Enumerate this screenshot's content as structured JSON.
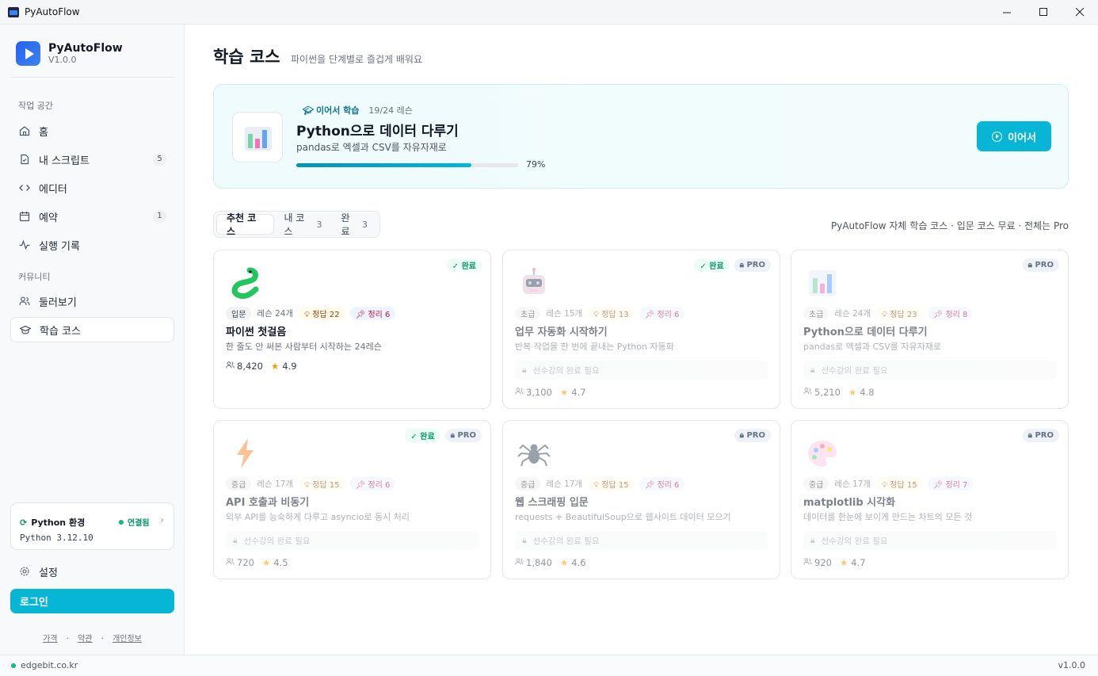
{
  "window": {
    "title": "PyAutoFlow"
  },
  "brand": {
    "name": "PyAutoFlow",
    "version": "V1.0.0"
  },
  "sidebar": {
    "workspace_label": "작업 공간",
    "items": [
      {
        "label": "홈",
        "icon": "home-icon"
      },
      {
        "label": "내 스크립트",
        "icon": "file-icon",
        "badge": "5"
      },
      {
        "label": "에디터",
        "icon": "code-icon"
      },
      {
        "label": "예약",
        "icon": "calendar-icon",
        "badge": "1"
      },
      {
        "label": "실행 기록",
        "icon": "activity-icon"
      }
    ],
    "community_label": "커뮤니티",
    "community_items": [
      {
        "label": "둘러보기",
        "icon": "users-icon"
      },
      {
        "label": "학습 코스",
        "icon": "graduation-cap-icon"
      }
    ],
    "python_env": {
      "title": "Python 환경",
      "status": "연결됨",
      "version": "Python 3.12.10"
    },
    "settings_label": "설정",
    "login_label": "로그인",
    "footer": {
      "pricing": "가격",
      "terms": "약관",
      "privacy": "개인정보"
    }
  },
  "statusbar": {
    "site": "edgebit.co.kr",
    "version": "v1.0.0"
  },
  "page": {
    "title": "학습 코스",
    "subtitle": "파이썬을 단계별로 즐겁게 배워요"
  },
  "hero": {
    "tag": "이어서 학습",
    "count": "19/24 레슨",
    "title": "Python으로 데이터 다루기",
    "subtitle": "pandas로 엑셀과 CSV를 자유자재로",
    "progress": 0.79,
    "progress_label": "79%",
    "button": "이어서"
  },
  "tabs": [
    {
      "label": "추천 코스",
      "count": ""
    },
    {
      "label": "내 코스",
      "count": "3"
    },
    {
      "label": "완료",
      "count": "3"
    }
  ],
  "tabs_note": "PyAutoFlow 자체 학습 코스 · 입문 코스 무료 · 전체는 Pro",
  "labels": {
    "done": "완료",
    "pro": "PRO",
    "lock": "선수강의 완료 필요"
  },
  "courses": [
    {
      "level": "입문",
      "lessons": "레슨 24개",
      "answers": "정답 22",
      "summary": "정리 6",
      "title": "파이썬 첫걸음",
      "desc": "한 줄도 안 써본 사람부터 시작하는 24레슨",
      "students": "8,420",
      "rating": "4.9",
      "done": true,
      "pro": false,
      "locked": false,
      "icon": "snake-icon"
    },
    {
      "level": "초급",
      "lessons": "레슨 15개",
      "answers": "정답 13",
      "summary": "정리 6",
      "title": "업무 자동화 시작하기",
      "desc": "반복 작업을 한 번에 끝내는 Python 자동화",
      "students": "3,100",
      "rating": "4.7",
      "done": true,
      "pro": true,
      "locked": true,
      "icon": "robot-icon"
    },
    {
      "level": "초급",
      "lessons": "레슨 24개",
      "answers": "정답 23",
      "summary": "정리 8",
      "title": "Python으로 데이터 다루기",
      "desc": "pandas로 엑셀과 CSV를 자유자재로",
      "students": "5,210",
      "rating": "4.8",
      "done": false,
      "pro": true,
      "locked": true,
      "icon": "bar-chart-icon"
    },
    {
      "level": "중급",
      "lessons": "레슨 17개",
      "answers": "정답 15",
      "summary": "정리 6",
      "title": "API 호출과 비동기",
      "desc": "외부 API를 능숙하게 다루고 asyncio로 동시 처리",
      "students": "720",
      "rating": "4.5",
      "done": true,
      "pro": true,
      "locked": true,
      "icon": "lightning-icon"
    },
    {
      "level": "중급",
      "lessons": "레슨 17개",
      "answers": "정답 15",
      "summary": "정리 6",
      "title": "웹 스크래핑 입문",
      "desc": "requests + BeautifulSoup으로 웹사이트 데이터 모으기",
      "students": "1,840",
      "rating": "4.6",
      "done": false,
      "pro": true,
      "locked": true,
      "icon": "spider-icon"
    },
    {
      "level": "중급",
      "lessons": "레슨 17개",
      "answers": "정답 15",
      "summary": "정리 7",
      "title": "matplotlib 시각화",
      "desc": "데이터를 한눈에 보이게 만드는 차트의 모든 것",
      "students": "920",
      "rating": "4.7",
      "done": false,
      "pro": true,
      "locked": true,
      "icon": "palette-icon"
    }
  ]
}
